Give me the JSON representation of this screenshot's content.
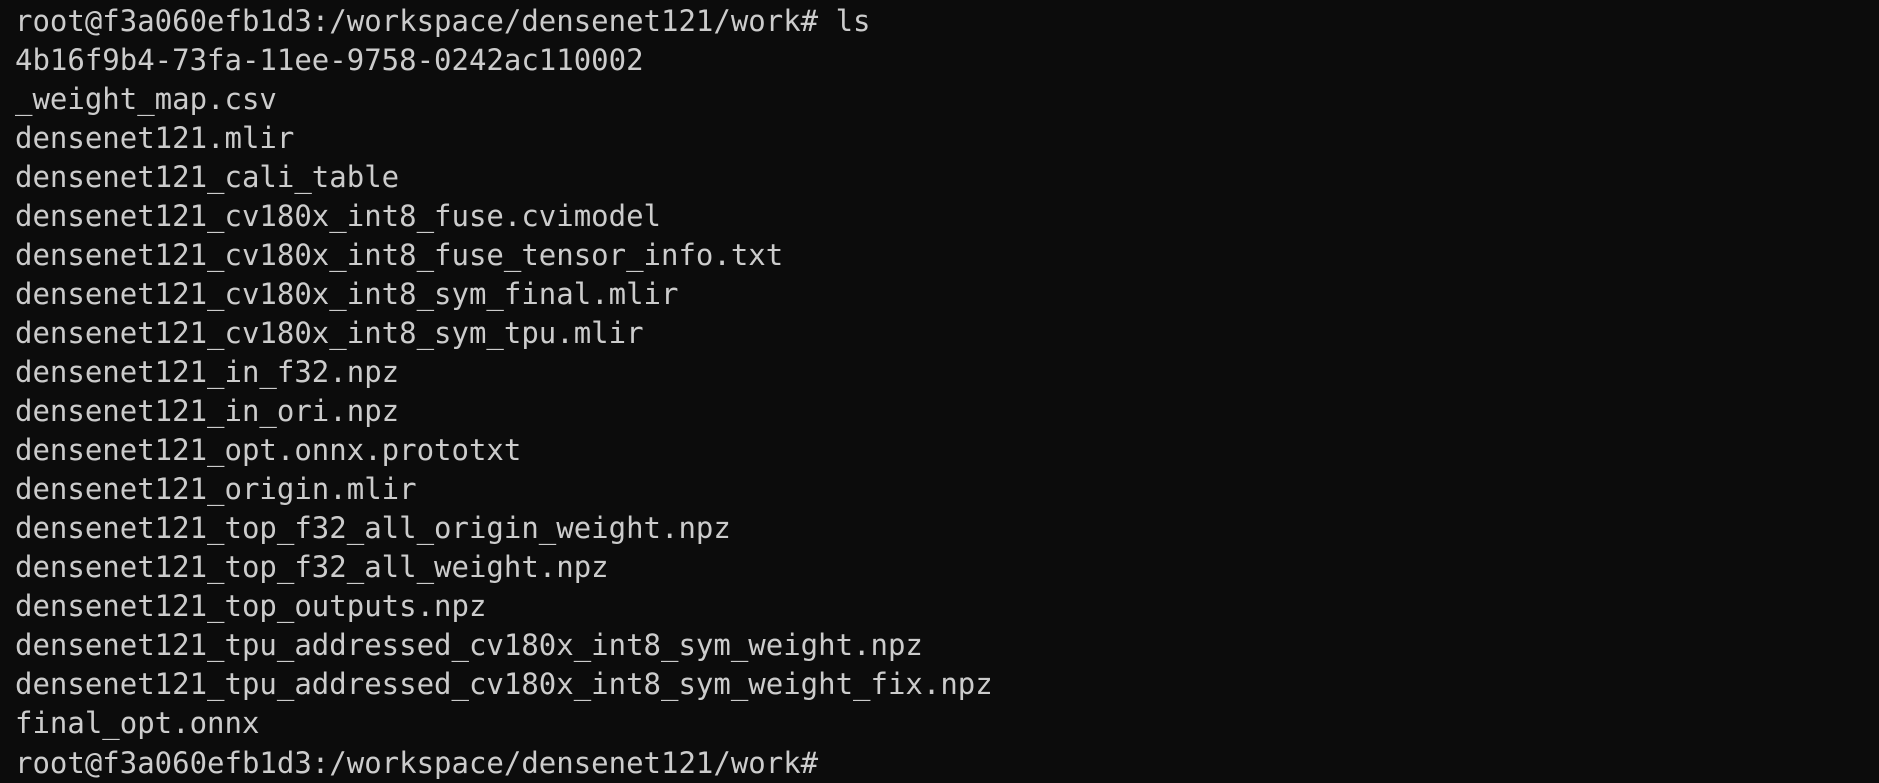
{
  "terminal": {
    "command_line": {
      "prompt": "root@f3a060efb1d3:/workspace/densenet121/work#",
      "command": " ls"
    },
    "output": [
      "4b16f9b4-73fa-11ee-9758-0242ac110002",
      "_weight_map.csv",
      "densenet121.mlir",
      "densenet121_cali_table",
      "densenet121_cv180x_int8_fuse.cvimodel",
      "densenet121_cv180x_int8_fuse_tensor_info.txt",
      "densenet121_cv180x_int8_sym_final.mlir",
      "densenet121_cv180x_int8_sym_tpu.mlir",
      "densenet121_in_f32.npz",
      "densenet121_in_ori.npz",
      "densenet121_opt.onnx.prototxt",
      "densenet121_origin.mlir",
      "densenet121_top_f32_all_origin_weight.npz",
      "densenet121_top_f32_all_weight.npz",
      "densenet121_top_outputs.npz",
      "densenet121_tpu_addressed_cv180x_int8_sym_weight.npz",
      "densenet121_tpu_addressed_cv180x_int8_sym_weight_fix.npz",
      "final_opt.onnx"
    ],
    "final_prompt": "root@f3a060efb1d3:/workspace/densenet121/work#"
  },
  "colors": {
    "background": "#0c0c0c",
    "foreground": "#cccccc"
  }
}
